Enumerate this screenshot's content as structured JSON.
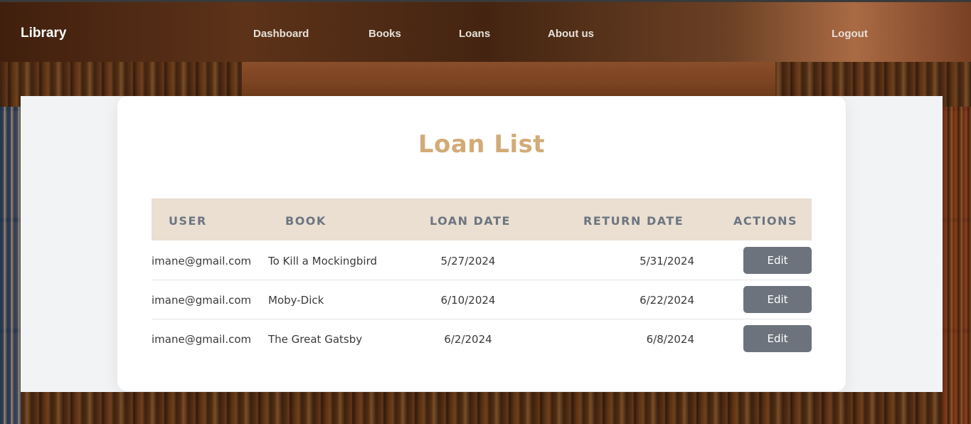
{
  "navbar": {
    "brand": "Library",
    "links": {
      "dashboard": "Dashboard",
      "books": "Books",
      "loans": "Loans",
      "about": "About us"
    },
    "logout": "Logout"
  },
  "page": {
    "title": "Loan List"
  },
  "table": {
    "headers": {
      "user": "USER",
      "book": "BOOK",
      "loan_date": "LOAN DATE",
      "return_date": "RETURN DATE",
      "actions": "ACTIONS"
    },
    "rows": [
      {
        "user": "imane@gmail.com",
        "book": "To Kill a Mockingbird",
        "loan_date": "5/27/2024",
        "return_date": "5/31/2024",
        "action": "Edit"
      },
      {
        "user": "imane@gmail.com",
        "book": "Moby-Dick",
        "loan_date": "6/10/2024",
        "return_date": "6/22/2024",
        "action": "Edit"
      },
      {
        "user": "imane@gmail.com",
        "book": "The Great Gatsby",
        "loan_date": "6/2/2024",
        "return_date": "6/8/2024",
        "action": "Edit"
      }
    ]
  },
  "colors": {
    "title": "#d2ab77",
    "table_header_bg": "#ebdfd2",
    "edit_button": "#6c737c",
    "panel_bg": "#f2f3f5"
  }
}
